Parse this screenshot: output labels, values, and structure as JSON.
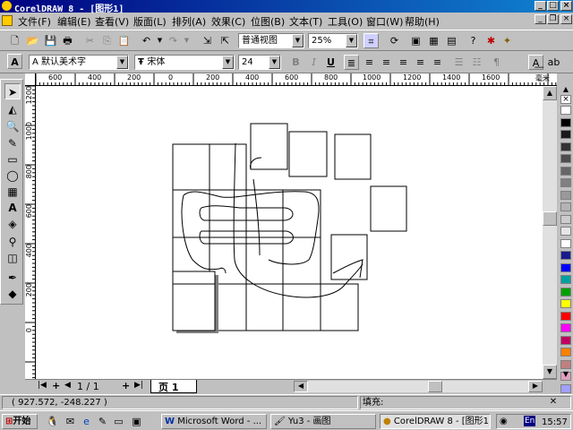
{
  "window": {
    "title": "CorelDRAW 8 - [图形1]",
    "controls": {
      "minimize": "_",
      "maximize": "□",
      "close": "×"
    }
  },
  "menu": {
    "items": [
      "文件(F)",
      "编辑(E)",
      "查看(V)",
      "版面(L)",
      "排列(A)",
      "效果(C)",
      "位图(B)",
      "文本(T)",
      "工具(O)",
      "窗口(W)",
      "帮助(H)"
    ]
  },
  "toolbar": {
    "view_select": "普通视图",
    "zoom_select": "25%"
  },
  "text_toolbar": {
    "art_text": "默认美术字",
    "font_name": "宋体",
    "font_size": "24",
    "bold": "B",
    "italic": "I",
    "underline": "U"
  },
  "ruler": {
    "h_labels": [
      "600",
      "400",
      "200",
      "0",
      "200",
      "400",
      "600",
      "800",
      "1000",
      "1200",
      "1400",
      "1600"
    ],
    "h_unit": "毫米",
    "v_labels": [
      "1200",
      "1000",
      "800",
      "600",
      "400",
      "200",
      "0"
    ]
  },
  "pages": {
    "nav_text": "1 / 1",
    "page_tab": "页 1"
  },
  "status": {
    "coords": "( 927.572, -248.227 )",
    "fill_label": "填充:"
  },
  "taskbar": {
    "start": "开始",
    "tasks": [
      "Microsoft Word - ...",
      "Yu3 - 画图",
      "CorelDRAW 8 - [图形1]"
    ],
    "lang": "En",
    "clock": "15:57"
  },
  "palette_colors": [
    "#ffffff",
    "#000000",
    "#1a1a1a",
    "#333333",
    "#4d4d4d",
    "#666666",
    "#808080",
    "#999999",
    "#b3b3b3",
    "#cccccc",
    "#e6e6e6",
    "#ffffff",
    "#1a1a8c",
    "#0000ff",
    "#00a0a0",
    "#00a000",
    "#ffff00",
    "#ff0000",
    "#ff00ff",
    "#c00060",
    "#ff8000",
    "#c08080",
    "#e0a0c0",
    "#a0a0ff"
  ]
}
